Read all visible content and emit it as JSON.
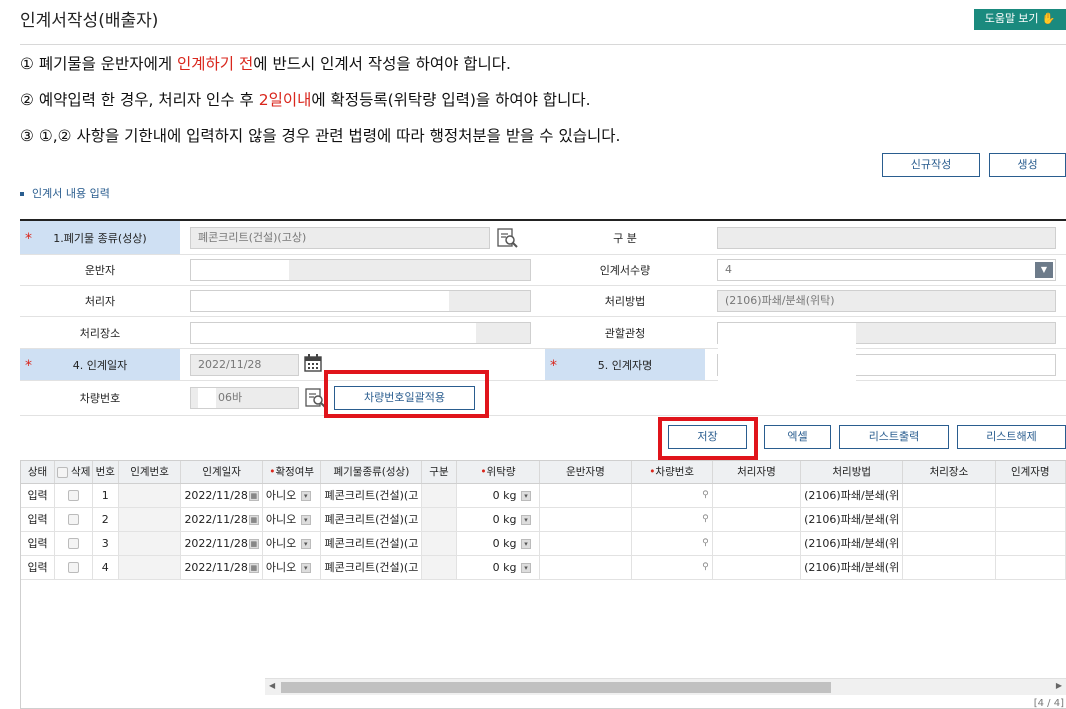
{
  "page": {
    "title": "인계서작성(배출자)",
    "help_label": "도움말 보기"
  },
  "notices": {
    "n1": {
      "pre": "① 폐기물을 운반자에게 ",
      "red": "인계하기 전",
      "post": "에 반드시 인계서 작성을 하여야 합니다."
    },
    "n2": {
      "pre": "② 예약입력 한 경우, 처리자 인수 후 ",
      "red": "2일이내",
      "post": "에 확정등록(위탁량 입력)을 하여야 합니다."
    },
    "n3": {
      "pre": "③ ①,② 사항을 기한내에 입력하지 않을 경우 관련 법령에 따라 행정처분을 받을 수 있습니다.",
      "red": "",
      "post": ""
    }
  },
  "actions": {
    "new_label": "신규작성",
    "create_label": "생성"
  },
  "section": {
    "label": "인계서 내용 입력"
  },
  "form": {
    "waste_type_label": "1.폐기물 종류(성상)",
    "waste_type_value": "폐콘크리트(건설)(고상)",
    "category_label": "구 분",
    "category_value": "",
    "carrier_label": "운반자",
    "quantity_label": "인계서수량",
    "quantity_value": "4",
    "processor_label": "처리자",
    "method_label": "처리방법",
    "method_value": "(2106)파쇄/분쇄(위탁)",
    "site_label": "처리장소",
    "authority_label": "관할관청",
    "date_label": "4. 인계일자",
    "date_value": "2022/11/28",
    "person_label": "5. 인계자명",
    "vehicle_label": "차량번호",
    "vehicle_value": "06바",
    "vehicle_apply_label": "차량번호일괄적용"
  },
  "grid_actions": {
    "save_label": "저장",
    "excel_label": "엑셀",
    "print_label": "리스트출력",
    "clear_label": "리스트해제"
  },
  "grid": {
    "headers": {
      "status": "상태",
      "delete": "삭제",
      "no": "번호",
      "handover_no": "인계번호",
      "date": "인계일자",
      "confirm": "확정여부",
      "waste": "폐기물종류(성상)",
      "type": "구분",
      "amount": "위탁량",
      "carrier": "운반자명",
      "vehicle": "차량번호",
      "processor": "처리자명",
      "method": "처리방법",
      "site": "처리장소",
      "person": "인계자명"
    },
    "rows": [
      {
        "status": "입력",
        "no": "1",
        "date": "2022/11/28",
        "confirm": "아니오",
        "waste": "폐콘크리트(건설)(고",
        "amount": "0",
        "unit": "kg",
        "method": "(2106)파쇄/분쇄(위"
      },
      {
        "status": "입력",
        "no": "2",
        "date": "2022/11/28",
        "confirm": "아니오",
        "waste": "폐콘크리트(건설)(고",
        "amount": "0",
        "unit": "kg",
        "method": "(2106)파쇄/분쇄(위"
      },
      {
        "status": "입력",
        "no": "3",
        "date": "2022/11/28",
        "confirm": "아니오",
        "waste": "폐콘크리트(건설)(고",
        "amount": "0",
        "unit": "kg",
        "method": "(2106)파쇄/분쇄(위"
      },
      {
        "status": "입력",
        "no": "4",
        "date": "2022/11/28",
        "confirm": "아니오",
        "waste": "폐콘크리트(건설)(고",
        "amount": "0",
        "unit": "kg",
        "method": "(2106)파쇄/분쇄(위"
      }
    ],
    "pager": "[4 / 4]"
  },
  "icons": {
    "lookup": "magnifier-document-icon",
    "calendar": "calendar-icon",
    "help": "pointer-hand-icon"
  },
  "colors": {
    "accent": "#1a8a7e",
    "highlight": "#e0141b",
    "required_bg": "#cfe0f3",
    "notice_red": "#d9261c"
  }
}
